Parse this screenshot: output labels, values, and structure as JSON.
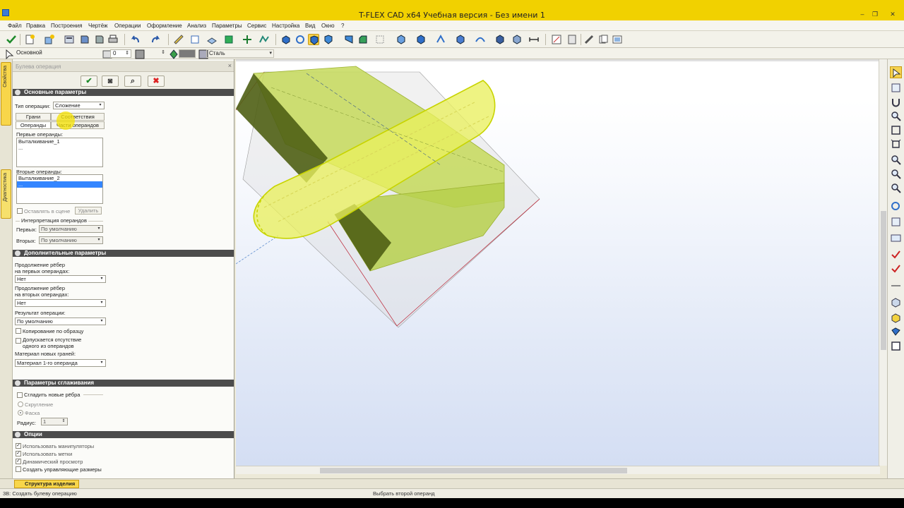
{
  "window": {
    "title": "T-FLEX CAD x64 Учебная версия - Без имени 1",
    "controls": [
      "–",
      "❐",
      "✕"
    ]
  },
  "menu": [
    "Файл",
    "Правка",
    "Построения",
    "Чертёж",
    "Операции",
    "Оформление",
    "Анализ",
    "Параметры",
    "Сервис",
    "Настройка",
    "Вид",
    "Окно",
    "?"
  ],
  "propbar": {
    "layer": "Основной",
    "level": "0",
    "material": "Сталь"
  },
  "left_tabs": {
    "properties": "Свойства",
    "diagnostics": "Диагностика"
  },
  "panel": {
    "header_title": "Булева операция",
    "close": "×",
    "buttons": {
      "ok": "✔",
      "preview": "◙",
      "find": "⌕",
      "cancel": "✖"
    },
    "main_section": {
      "title": "Основные параметры",
      "op_type_label": "Тип операции:",
      "op_type_value": "Сложение",
      "tabs_row1": [
        "Грани",
        "Соответствия"
      ],
      "tabs_row2": [
        "Операнды",
        "Части операндов"
      ],
      "first_ops_label": "Первые операнды:",
      "first_ops": [
        "Выталкивание_1",
        "..."
      ],
      "second_ops_label": "Вторые операнды:",
      "second_ops": [
        "Выталкивание_2",
        "..."
      ],
      "keep_in_scene": "Оставлять в сцене",
      "delete_button": "Удалить",
      "interp_label": "Интерпретация операндов",
      "first_label": "Первых:",
      "first_value": "По умолчанию",
      "second_label": "Вторых:",
      "second_value": "По умолчанию"
    },
    "extra_section": {
      "title": "Дополнительные параметры",
      "ext_first_l1": "Продолжение рёбер",
      "ext_first_l2": "на первых операндах:",
      "ext_first_value": "Нет",
      "ext_second_l1": "Продолжение рёбер",
      "ext_second_l2": "на вторых операндах:",
      "ext_second_value": "Нет",
      "result_label": "Результат операции:",
      "result_value": "По умолчанию",
      "copy_pattern": "Копирование по образцу",
      "allow_missing_l1": "Допускается отсутствие",
      "allow_missing_l2": "одного из операндов",
      "material_label": "Материал новых граней:",
      "material_value": "Материал 1-го операнда"
    },
    "smooth_section": {
      "title": "Параметры сглаживания",
      "smooth_new_edges": "Сгладить новые рёбра",
      "fillet": "Скругление",
      "chamfer": "Фаска",
      "radius_label": "Радиус:",
      "radius_value": "1"
    },
    "options_section": {
      "title": "Опции",
      "use_manipulators": "Использовать манипуляторы",
      "use_marks": "Использовать метки",
      "dynamic_preview": "Динамический просмотр",
      "create_driving_dims": "Создать управляющие размеры"
    }
  },
  "bottom_tab": "Структура изделия",
  "status": {
    "left": "3B: Создать булеву операцию",
    "center": "Выбрать второй операнд"
  },
  "colors": {
    "title_bar": "#f1d100",
    "section_header": "#4c4c4c",
    "selection": "#3385ff",
    "model_yellow": "#e5ef4a",
    "model_dark": "#6c8220"
  },
  "icons": [
    "save-icon",
    "undo-icon",
    "redo-icon",
    "zoom-icon",
    "rotate-icon",
    "boolean-icon"
  ]
}
